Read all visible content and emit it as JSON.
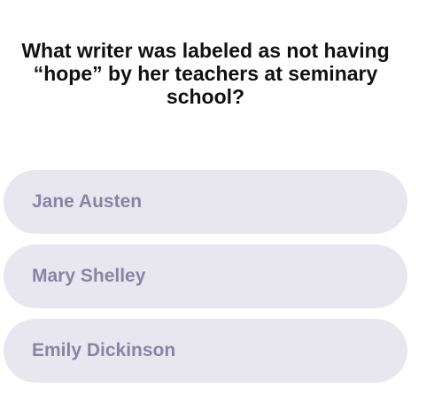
{
  "quiz": {
    "question": "What writer was labeled as not having “hope” by her teachers at seminary school?",
    "options": [
      {
        "label": "Jane Austen"
      },
      {
        "label": "Mary Shelley"
      },
      {
        "label": "Emily Dickinson"
      }
    ]
  },
  "colors": {
    "option_background": "#e8e7ef",
    "option_text": "#8a84a4",
    "question_text": "#111111"
  }
}
